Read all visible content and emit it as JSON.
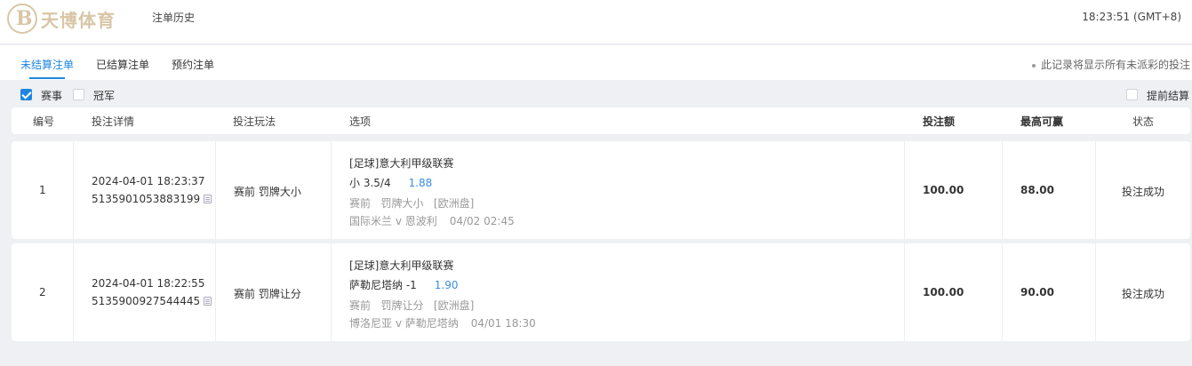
{
  "header": {
    "logo_letter": "B",
    "logo_text": "天博体育",
    "title": "注单历史",
    "clock": "18:23:51 (GMT+8)"
  },
  "tabs": [
    {
      "label": "未结算注单",
      "active": true
    },
    {
      "label": "已结算注单",
      "active": false
    },
    {
      "label": "预约注单",
      "active": false
    }
  ],
  "tab_note": "此记录将显示所有未派彩的投注",
  "filters": {
    "event": {
      "label": "赛事",
      "checked": true
    },
    "outright": {
      "label": "冠军",
      "checked": false
    },
    "early_settle": {
      "label": "提前结算",
      "checked": false
    }
  },
  "columns": [
    "编号",
    "投注详情",
    "投注玩法",
    "选项",
    "投注额",
    "最高可赢",
    "状态"
  ],
  "bets": [
    {
      "no": "1",
      "time": "2024-04-01 18:23:37",
      "ticket": "5135901053883199",
      "play": "赛前 罚牌大小",
      "league": "[足球]意大利甲级联赛",
      "pick": "小 3.5/4",
      "odds": "1.88",
      "market": "赛前   罚牌大小   [欧洲盘]",
      "match": "国际米兰 v 恩波利",
      "kickoff": "04/02 02:45",
      "stake": "100.00",
      "max_win": "88.00",
      "status": "投注成功"
    },
    {
      "no": "2",
      "time": "2024-04-01 18:22:55",
      "ticket": "5135900927544445",
      "play": "赛前 罚牌让分",
      "league": "[足球]意大利甲级联赛",
      "pick": "萨勒尼塔纳 -1",
      "odds": "1.90",
      "market": "赛前   罚牌让分   [欧洲盘]",
      "match": "博洛尼亚 v 萨勒尼塔纳",
      "kickoff": "04/01 18:30",
      "stake": "100.00",
      "max_win": "90.00",
      "status": "投注成功"
    }
  ],
  "colors": {
    "accent": "#1e86e0",
    "odds": "#3b8ee0",
    "logo": "#d8c6a6",
    "background": "#eef0f4"
  }
}
